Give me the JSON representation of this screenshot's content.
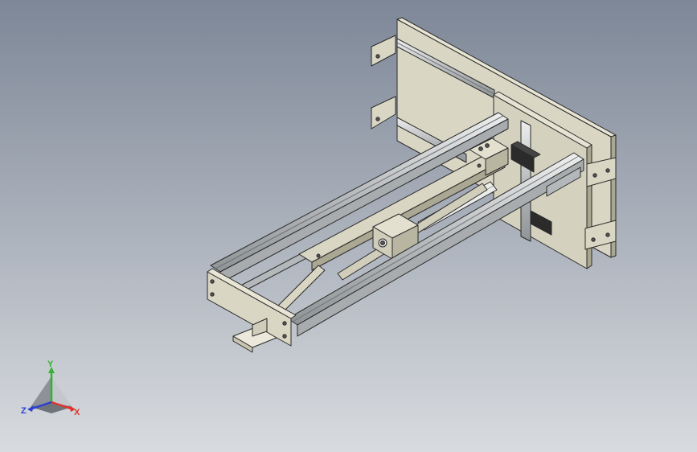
{
  "viewport": {
    "background_top": "#7d8797",
    "background_bottom": "#d8dbdf"
  },
  "model": {
    "frame_color": "#d9d6c4",
    "frame_shadow": "#aaa792",
    "rail_color": "#c8cacb",
    "rail_dark": "#8f9496",
    "edge_color": "#2a2a2a",
    "motor_color": "#2b2b2b",
    "screw_color": "#ececea"
  },
  "triad": {
    "x_label": "X",
    "y_label": "Y",
    "z_label": "Z",
    "x_color": "#e0352b",
    "y_color": "#34b233",
    "z_color": "#2e3fd1"
  }
}
